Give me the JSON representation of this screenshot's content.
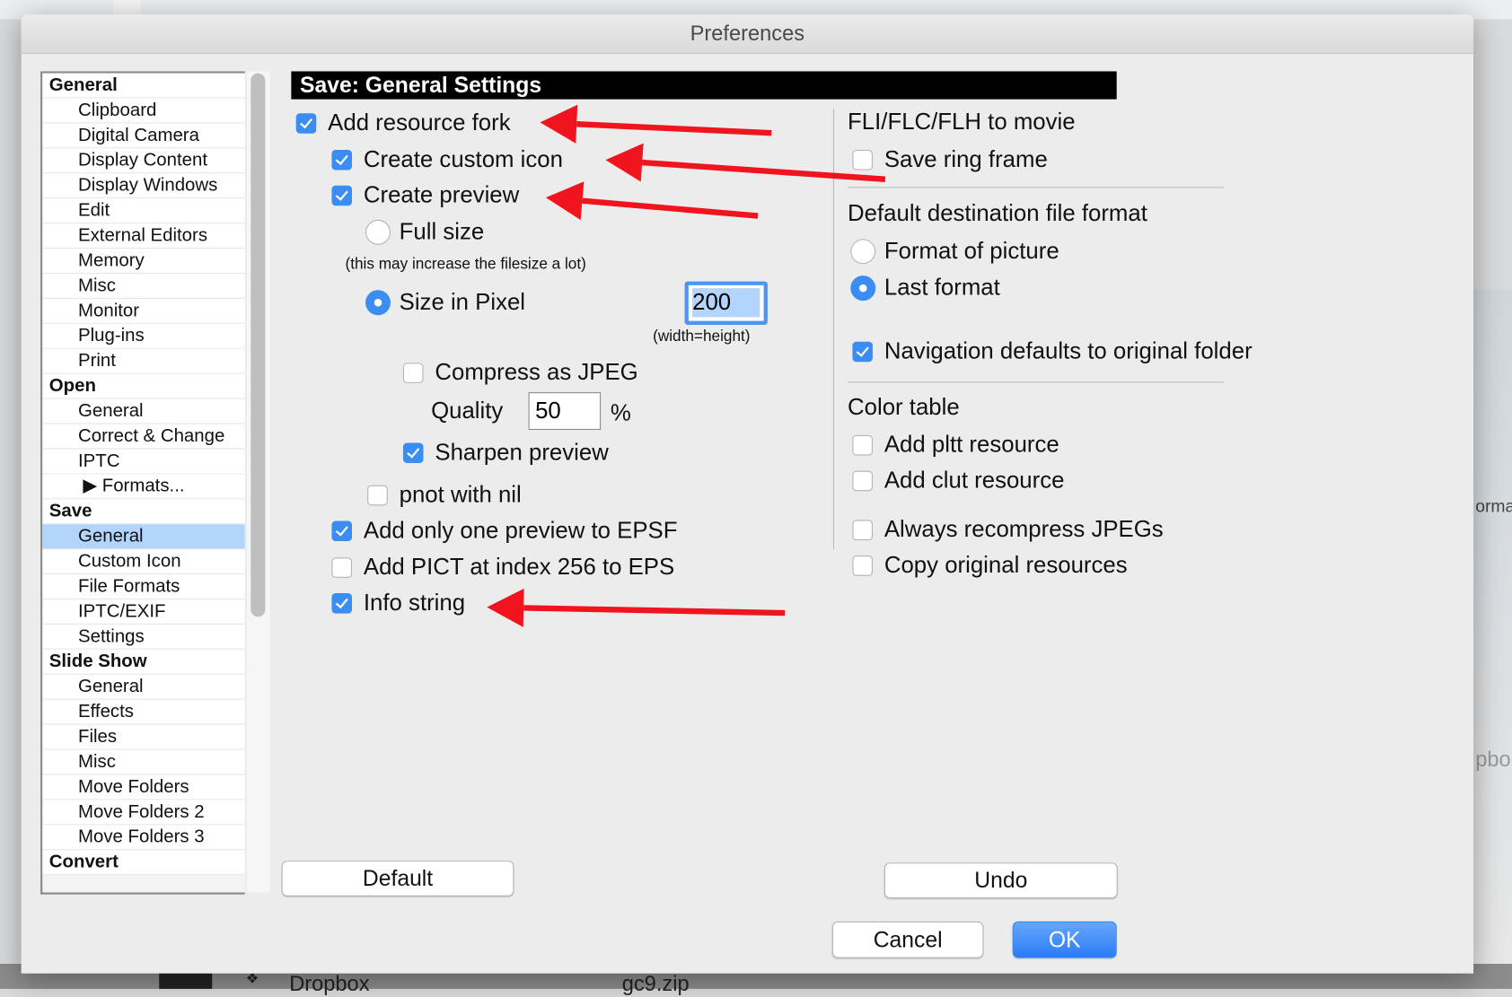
{
  "window": {
    "title": "Preferences"
  },
  "background": {
    "bottom_items": [
      "Dropbox",
      "gc9.zip"
    ],
    "right_partial_texts": [
      "orma",
      "pbo"
    ]
  },
  "sidebar": {
    "items": [
      {
        "label": "General",
        "level": "header"
      },
      {
        "label": "Clipboard",
        "level": "child"
      },
      {
        "label": "Digital Camera",
        "level": "child"
      },
      {
        "label": "Display Content",
        "level": "child"
      },
      {
        "label": "Display Windows",
        "level": "child"
      },
      {
        "label": "Edit",
        "level": "child"
      },
      {
        "label": "External Editors",
        "level": "child"
      },
      {
        "label": "Memory",
        "level": "child"
      },
      {
        "label": "Misc",
        "level": "child"
      },
      {
        "label": "Monitor",
        "level": "child"
      },
      {
        "label": "Plug-ins",
        "level": "child"
      },
      {
        "label": "Print",
        "level": "child"
      },
      {
        "label": "Open",
        "level": "header"
      },
      {
        "label": "General",
        "level": "child"
      },
      {
        "label": "Correct & Change",
        "level": "child"
      },
      {
        "label": "IPTC",
        "level": "child"
      },
      {
        "label": "▶ Formats...",
        "level": "sub"
      },
      {
        "label": "Save",
        "level": "header"
      },
      {
        "label": "General",
        "level": "child",
        "selected": true
      },
      {
        "label": "Custom Icon",
        "level": "child"
      },
      {
        "label": "File Formats",
        "level": "child"
      },
      {
        "label": "IPTC/EXIF",
        "level": "child"
      },
      {
        "label": "Settings",
        "level": "child"
      },
      {
        "label": "Slide Show",
        "level": "header"
      },
      {
        "label": "General",
        "level": "child"
      },
      {
        "label": "Effects",
        "level": "child"
      },
      {
        "label": "Files",
        "level": "child"
      },
      {
        "label": "Misc",
        "level": "child"
      },
      {
        "label": "Move Folders",
        "level": "child"
      },
      {
        "label": "Move Folders 2",
        "level": "child"
      },
      {
        "label": "Move Folders 3",
        "level": "child"
      },
      {
        "label": "Convert",
        "level": "header"
      }
    ]
  },
  "panel": {
    "header": "Save: General Settings",
    "add_resource_fork": {
      "label": "Add resource fork",
      "checked": true
    },
    "create_custom_icon": {
      "label": "Create custom icon",
      "checked": true
    },
    "create_preview": {
      "label": "Create preview",
      "checked": true
    },
    "full_size": {
      "label": "Full size",
      "selected": false
    },
    "full_size_note": "(this may increase the filesize a lot)",
    "size_in_pixel": {
      "label": "Size in Pixel",
      "selected": true,
      "value": "200",
      "note": "(width=height)"
    },
    "compress_jpeg": {
      "label": "Compress as JPEG",
      "checked": false
    },
    "quality": {
      "label": "Quality",
      "value": "50",
      "unit": "%"
    },
    "sharpen_preview": {
      "label": "Sharpen preview",
      "checked": true
    },
    "pnot_with_nil": {
      "label": "pnot with nil",
      "checked": false
    },
    "one_preview_epsf": {
      "label": "Add only one preview to EPSF",
      "checked": true
    },
    "add_pict_eps": {
      "label": "Add PICT at index 256 to EPS",
      "checked": false
    },
    "info_string": {
      "label": "Info string",
      "checked": true
    },
    "fli_heading": "FLI/FLC/FLH to movie",
    "save_ring_frame": {
      "label": "Save ring frame",
      "checked": false
    },
    "dest_heading": "Default destination file format",
    "format_of_picture": {
      "label": "Format of picture",
      "selected": false
    },
    "last_format": {
      "label": "Last format",
      "selected": true
    },
    "nav_defaults": {
      "label": "Navigation defaults to original folder",
      "checked": true
    },
    "color_table_heading": "Color table",
    "add_pltt": {
      "label": "Add pltt resource",
      "checked": false
    },
    "add_clut": {
      "label": "Add clut resource",
      "checked": false
    },
    "always_recompress": {
      "label": "Always recompress JPEGs",
      "checked": false
    },
    "copy_original": {
      "label": "Copy original resources",
      "checked": false
    }
  },
  "buttons": {
    "default": "Default",
    "undo": "Undo",
    "cancel": "Cancel",
    "ok": "OK"
  },
  "annotation_color": "#f0141e"
}
